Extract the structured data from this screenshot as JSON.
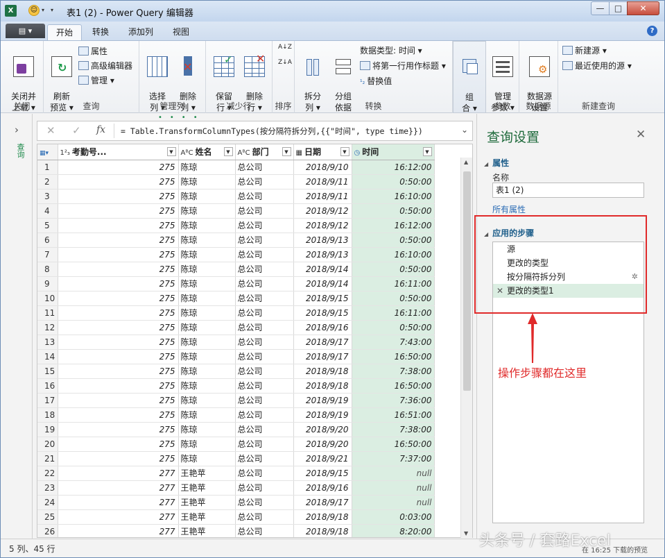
{
  "window": {
    "title": "表1 (2) - Power Query 编辑器",
    "app_icon": "X",
    "smile": "☺",
    "minimize": "—",
    "maximize": "□",
    "close": "✕"
  },
  "tabs": {
    "file_label": "▤ ▾",
    "items": [
      "开始",
      "转换",
      "添加列",
      "视图"
    ],
    "active": "开始",
    "help": "?"
  },
  "ribbon": {
    "close_group": {
      "label": "关闭",
      "close_load": "关闭并\n上载 ▾"
    },
    "query_group": {
      "label": "查询",
      "refresh": "刷新\n预览 ▾",
      "properties": "属性",
      "advanced_editor": "高级编辑器",
      "manage": "管理 ▾"
    },
    "manage_cols_group": {
      "label": "管理列",
      "choose_cols": "选择\n列 ▾",
      "remove_cols": "删除\n列 ▾"
    },
    "reduce_rows_group": {
      "label": "减少行",
      "keep_rows": "保留\n行 ▾",
      "remove_rows": "删除\n行 ▾"
    },
    "sort_group": {
      "label": "排序",
      "sort_asc": "A↓Z",
      "sort_desc": "Z↓A"
    },
    "transform_group": {
      "label": "转换",
      "split_col": "拆分\n列 ▾",
      "group_by": "分组\n依据",
      "data_type": "数据类型: 时间 ▾",
      "first_row_header": "将第一行用作标题 ▾",
      "replace_values": "替换值"
    },
    "combine_group": {
      "label": "",
      "combine": "组\n合 ▾"
    },
    "params_group": {
      "label": "参数",
      "manage_params": "管理\n参数 ▾"
    },
    "datasource_group": {
      "label": "数据源",
      "datasource_settings": "数据源\n设置"
    },
    "newquery_group": {
      "label": "新建查询",
      "new_source": "新建源 ▾",
      "recent_sources": "最近使用的源 ▾"
    }
  },
  "left_pane": {
    "expand": "›",
    "label": "查询"
  },
  "formula_bar": {
    "cancel": "✕",
    "accept": "✓",
    "fx": "fx",
    "formula": "= Table.TransformColumnTypes(按分隔符拆分列,{{\"时间\", type time}})",
    "expand": "⌄"
  },
  "table": {
    "columns": [
      {
        "type": "1²₃",
        "name": "考勤号..."
      },
      {
        "type": "AᴮC",
        "name": "姓名"
      },
      {
        "type": "AᴮC",
        "name": "部门"
      },
      {
        "type": "▦",
        "name": "日期"
      },
      {
        "type": "◷",
        "name": "时间"
      }
    ],
    "corner_icon": "▦▾",
    "rows": [
      [
        "1",
        "275",
        "陈琼",
        "总公司",
        "2018/9/10",
        "16:12:00"
      ],
      [
        "2",
        "275",
        "陈琼",
        "总公司",
        "2018/9/11",
        "0:50:00"
      ],
      [
        "3",
        "275",
        "陈琼",
        "总公司",
        "2018/9/11",
        "16:10:00"
      ],
      [
        "4",
        "275",
        "陈琼",
        "总公司",
        "2018/9/12",
        "0:50:00"
      ],
      [
        "5",
        "275",
        "陈琼",
        "总公司",
        "2018/9/12",
        "16:12:00"
      ],
      [
        "6",
        "275",
        "陈琼",
        "总公司",
        "2018/9/13",
        "0:50:00"
      ],
      [
        "7",
        "275",
        "陈琼",
        "总公司",
        "2018/9/13",
        "16:10:00"
      ],
      [
        "8",
        "275",
        "陈琼",
        "总公司",
        "2018/9/14",
        "0:50:00"
      ],
      [
        "9",
        "275",
        "陈琼",
        "总公司",
        "2018/9/14",
        "16:11:00"
      ],
      [
        "10",
        "275",
        "陈琼",
        "总公司",
        "2018/9/15",
        "0:50:00"
      ],
      [
        "11",
        "275",
        "陈琼",
        "总公司",
        "2018/9/15",
        "16:11:00"
      ],
      [
        "12",
        "275",
        "陈琼",
        "总公司",
        "2018/9/16",
        "0:50:00"
      ],
      [
        "13",
        "275",
        "陈琼",
        "总公司",
        "2018/9/17",
        "7:43:00"
      ],
      [
        "14",
        "275",
        "陈琼",
        "总公司",
        "2018/9/17",
        "16:50:00"
      ],
      [
        "15",
        "275",
        "陈琼",
        "总公司",
        "2018/9/18",
        "7:38:00"
      ],
      [
        "16",
        "275",
        "陈琼",
        "总公司",
        "2018/9/18",
        "16:50:00"
      ],
      [
        "17",
        "275",
        "陈琼",
        "总公司",
        "2018/9/19",
        "7:36:00"
      ],
      [
        "18",
        "275",
        "陈琼",
        "总公司",
        "2018/9/19",
        "16:51:00"
      ],
      [
        "19",
        "275",
        "陈琼",
        "总公司",
        "2018/9/20",
        "7:38:00"
      ],
      [
        "20",
        "275",
        "陈琼",
        "总公司",
        "2018/9/20",
        "16:50:00"
      ],
      [
        "21",
        "275",
        "陈琼",
        "总公司",
        "2018/9/21",
        "7:37:00"
      ],
      [
        "22",
        "277",
        "王艳苹",
        "总公司",
        "2018/9/15",
        "null"
      ],
      [
        "23",
        "277",
        "王艳苹",
        "总公司",
        "2018/9/16",
        "null"
      ],
      [
        "24",
        "277",
        "王艳苹",
        "总公司",
        "2018/9/17",
        "null"
      ],
      [
        "25",
        "277",
        "王艳苹",
        "总公司",
        "2018/9/18",
        "0:03:00"
      ],
      [
        "26",
        "277",
        "王艳苹",
        "总公司",
        "2018/9/18",
        "8:20:00"
      ]
    ]
  },
  "query_settings": {
    "title": "查询设置",
    "close": "✕",
    "properties_header": "属性",
    "name_label": "名称",
    "name_value": "表1 (2)",
    "all_properties": "所有属性",
    "applied_steps_header": "应用的步骤",
    "steps": [
      "源",
      "更改的类型",
      "按分隔符拆分列",
      "更改的类型1"
    ],
    "active_step": "更改的类型1",
    "annotation": "操作步骤都在这里"
  },
  "status": {
    "left": "5 列、45 行",
    "right": "在 16:25 下载的预览"
  },
  "watermark": "头条号 / 套路Excel",
  "colors": {
    "accent_green": "#1e6a3b",
    "selected_col": "#dbeee2",
    "annotation_red": "#e02a2a"
  }
}
